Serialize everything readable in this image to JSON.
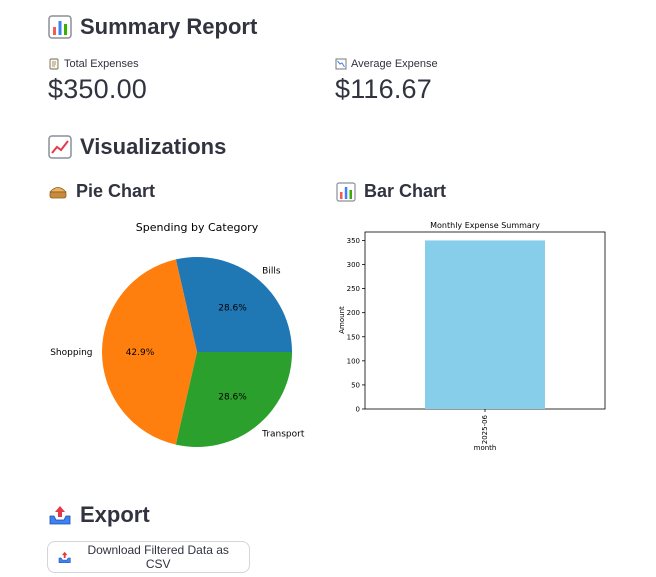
{
  "summary": {
    "title": "Summary Report",
    "metrics": [
      {
        "label": "Total Expenses",
        "value": "$350.00"
      },
      {
        "label": "Average Expense",
        "value": "$116.67"
      }
    ]
  },
  "visualizations": {
    "title": "Visualizations",
    "pie_title": "Pie Chart",
    "bar_title": "Bar Chart"
  },
  "export": {
    "title": "Export",
    "button_label": "Download Filtered Data as CSV"
  },
  "colors": {
    "pie_bills": "#1f77b4",
    "pie_shopping": "#ff7f0e",
    "pie_transport": "#2ca02c",
    "bar": "#87ceeb"
  },
  "chart_data": [
    {
      "type": "pie",
      "title": "Spending by Category",
      "labels": [
        "Bills",
        "Shopping",
        "Transport"
      ],
      "values": [
        28.6,
        42.9,
        28.6
      ],
      "value_labels": [
        "28.6%",
        "42.9%",
        "28.6%"
      ]
    },
    {
      "type": "bar",
      "title": "Monthly Expense Summary",
      "categories": [
        "2025-06"
      ],
      "values": [
        350
      ],
      "xlabel": "month",
      "ylabel": "Amount",
      "ylim": [
        0,
        367.5
      ],
      "yticks": [
        0,
        50,
        100,
        150,
        200,
        250,
        300,
        350
      ]
    }
  ]
}
